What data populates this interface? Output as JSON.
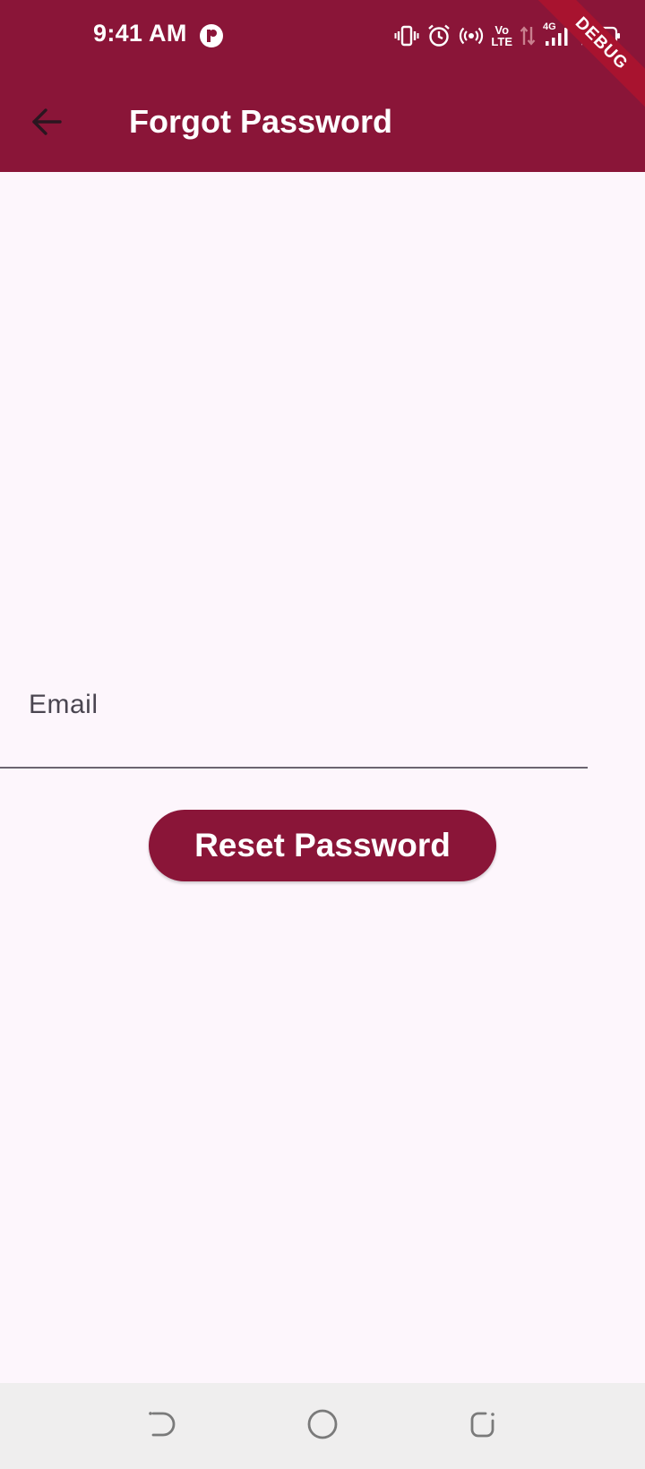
{
  "status_bar": {
    "time": "9:41 AM",
    "app_icon": "app-notification-icon",
    "icons": [
      "vibrate-icon",
      "alarm-icon",
      "hotspot-icon",
      "volte-icon",
      "data-arrows-icon",
      "signal-4g-icon",
      "battery-charging-icon"
    ],
    "volte_label_top": "Vo",
    "volte_label_bottom": "LTE",
    "network_label": "4G"
  },
  "debug_banner": {
    "label": "DEBUG"
  },
  "app_bar": {
    "title": "Forgot Password",
    "back_icon": "arrow-back-icon",
    "background": "#8a1538"
  },
  "form": {
    "email_label": "Email",
    "email_value": "",
    "submit_label": "Reset Password",
    "accent": "#8a1538"
  },
  "nav_bar": {
    "icons": [
      "back-nav-icon",
      "home-nav-icon",
      "recents-nav-icon"
    ]
  },
  "colors": {
    "primary": "#8a1538",
    "background": "#fdf6fc",
    "nav_bar": "#efeeee"
  }
}
